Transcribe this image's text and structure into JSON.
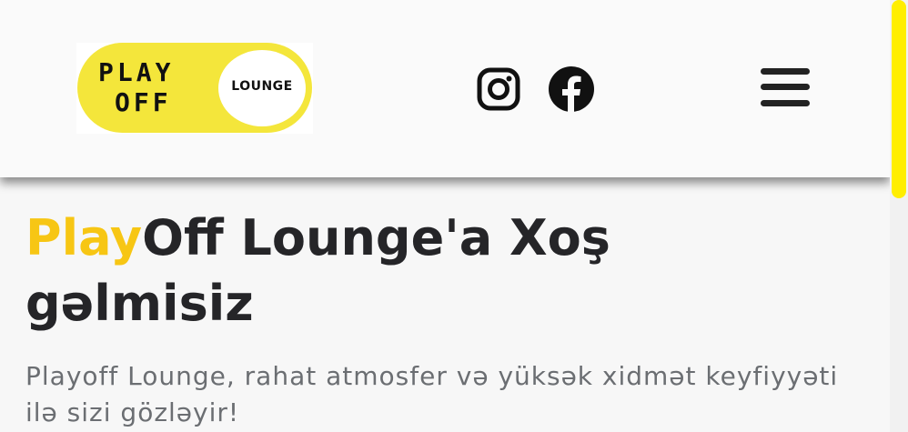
{
  "header": {
    "logo": {
      "word1": "PLAY",
      "word2": "OFF",
      "word3": "LOUNGE",
      "colors": {
        "pill": "#f4e63b",
        "circle": "#ffffff",
        "text": "#111111"
      }
    },
    "social": [
      {
        "icon": "instagram-icon"
      },
      {
        "icon": "facebook-icon"
      }
    ],
    "menu": {
      "icon": "hamburger-menu-icon"
    }
  },
  "hero": {
    "title_accent": "Play",
    "title_rest": "Off Lounge'a Xoş gəlmisiz",
    "subtitle": "Playoff Lounge, rahat atmosfer və yüksək xidmət keyfiyyəti ilə sizi gözləyir!"
  },
  "colors": {
    "accent": "#f7c614",
    "scrollbar_thumb": "#ffee00",
    "title": "#252528",
    "subtitle": "#6b6e72"
  }
}
